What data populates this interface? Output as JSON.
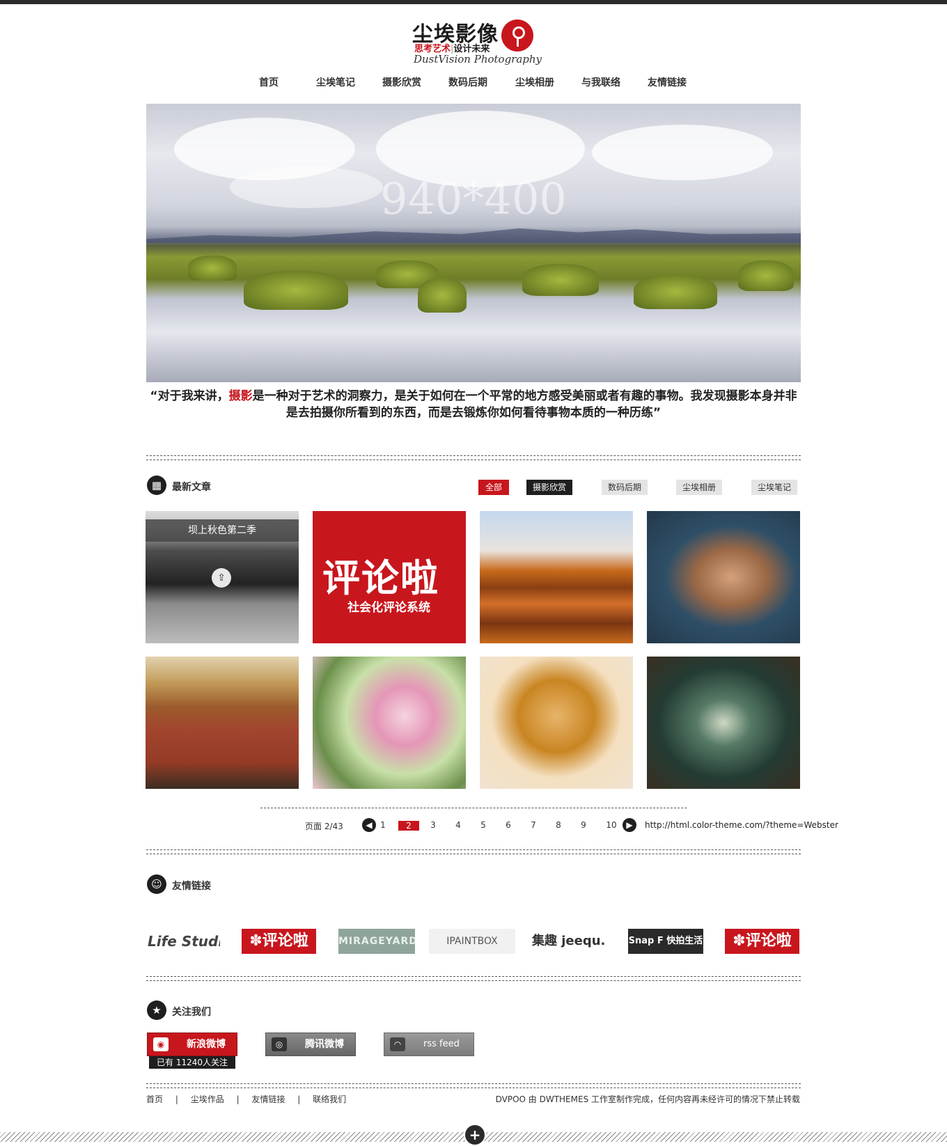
{
  "brand": {
    "name_cn": "尘埃影像",
    "tagline_red": "思考艺术",
    "tagline_sep": "|",
    "tagline_black": "设计未来",
    "name_en": "DustVision Photography",
    "logo_icon": "camera-tripod-icon",
    "accent_color": "#c8161d"
  },
  "nav": {
    "items": [
      {
        "label": "首页"
      },
      {
        "label": "尘埃笔记"
      },
      {
        "label": "摄影欣赏"
      },
      {
        "label": "数码后期"
      },
      {
        "label": "尘埃相册"
      },
      {
        "label": "与我联络"
      },
      {
        "label": "友情链接"
      }
    ]
  },
  "banner": {
    "size_text": "940*400"
  },
  "quote": {
    "part1": "“对于我来讲，",
    "highlight": "摄影",
    "part2": "是一种对于艺术的洞察力，是关于如何在一个平常的地方感受美丽或者有趣的事物。我发现摄影本身并非是去拍摄你所看到的东西，而是去锻炼你如何看待事物本质的一种历练”"
  },
  "latest": {
    "title": "最新文章",
    "icon": "grid-icon",
    "filters": [
      {
        "label": "全部",
        "state": "all"
      },
      {
        "label": "摄影欣赏",
        "state": "active"
      },
      {
        "label": "数码后期",
        "state": "off"
      },
      {
        "label": "尘埃相册",
        "state": "off"
      },
      {
        "label": "尘埃笔记",
        "state": "off"
      }
    ],
    "tiles": [
      {
        "caption": "坝上秋色第二季",
        "share_icon": "share-icon"
      },
      {
        "big_text": "评论啦",
        "small_text": "社会化评论系统"
      },
      {},
      {},
      {},
      {},
      {},
      {}
    ]
  },
  "pager": {
    "label": "页面",
    "position": "2/43",
    "prev_icon": "arrow-left-icon",
    "next_icon": "arrow-right-icon",
    "pages": [
      "1",
      "2",
      "3",
      "4",
      "5",
      "6",
      "7",
      "8",
      "9",
      "10"
    ],
    "current": "2",
    "url": "http://html.color-theme.com/?theme=Webster"
  },
  "links": {
    "title": "友情链接",
    "icon": "smiley-icon",
    "logos": [
      "Life Studio",
      "✽评论啦",
      "MIRAGEYARD",
      "IPAINTBOX",
      "集趣 jeequ.com",
      "Snap F 快拍生活",
      "✽评论啦"
    ]
  },
  "follow": {
    "title": "关注我们",
    "icon": "star-icon",
    "buttons": [
      {
        "label": "新浪微博",
        "icon": "weibo-icon"
      },
      {
        "label": "腾讯微博",
        "icon": "tencent-weibo-icon"
      },
      {
        "label": "rss feed",
        "icon": "rss-icon"
      }
    ],
    "count": "已有 11240人关注"
  },
  "footer": {
    "nav": [
      "首页",
      "尘埃作品",
      "友情链接",
      "联络我们"
    ],
    "separator": "|",
    "copyright": "DVPOO 由 DWTHEMES 工作室制作完成，任何内容再未经许可的情况下禁止转载",
    "expand_icon": "plus-icon"
  }
}
